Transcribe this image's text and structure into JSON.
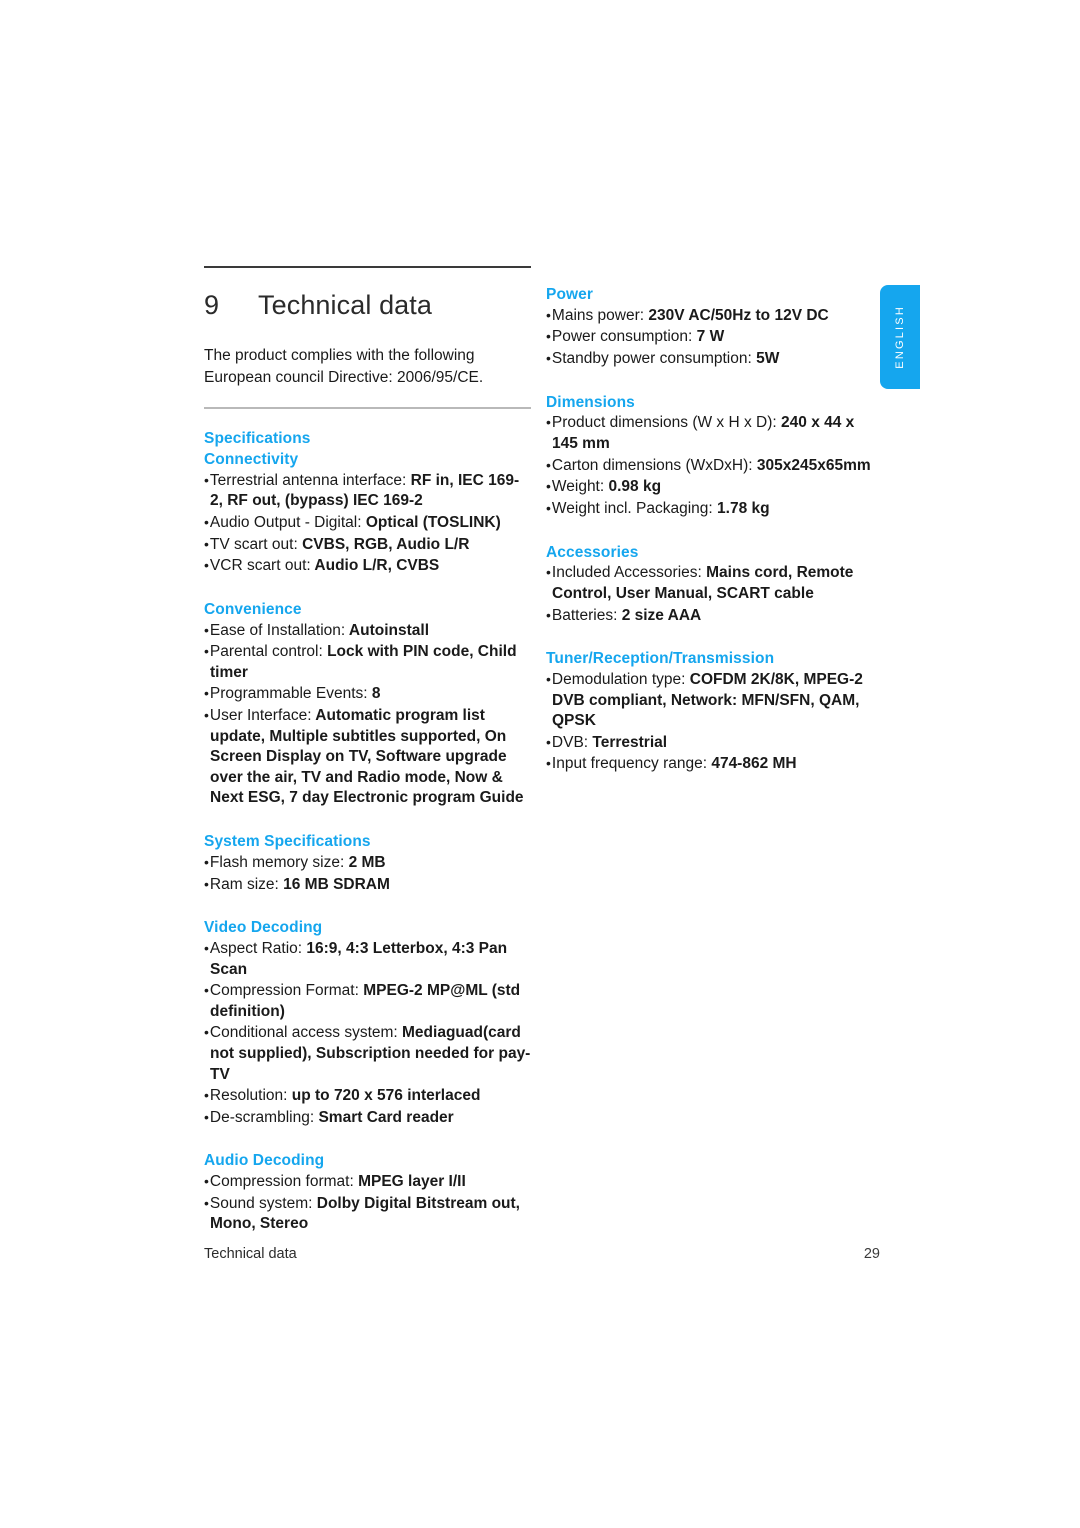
{
  "page": {
    "language_tab": "ENGLISH",
    "accent_color": "#15A6EE",
    "footer_left": "Technical data",
    "footer_page_number": "29"
  },
  "chapter": {
    "number": "9",
    "title": "Technical data",
    "intro": "The product complies with the following European council Directive: 2006/95/CE."
  },
  "left_column": {
    "specifications_heading": "Specifications",
    "sections": [
      {
        "heading": "Connectivity",
        "items": [
          "Terrestrial antenna interface: RF in, IEC 169-2, RF out, (bypass) IEC 169-2",
          "Audio Output - Digital: Optical (TOSLINK)",
          "TV scart out: CVBS, RGB, Audio L/R",
          "VCR scart out: Audio L/R, CVBS"
        ]
      },
      {
        "heading": "Convenience",
        "items": [
          "Ease of Installation: Autoinstall",
          "Parental control: Lock with PIN code, Child timer",
          "Programmable Events: 8",
          "User Interface: Automatic program list update, Multiple subtitles supported, On Screen Display on TV, Software upgrade over the air, TV and Radio mode, Now & Next ESG, 7 day Electronic program Guide"
        ]
      },
      {
        "heading": "System Specifications",
        "items": [
          "Flash memory size: 2 MB",
          "Ram size: 16 MB SDRAM"
        ]
      },
      {
        "heading": "Video Decoding",
        "items": [
          "Aspect Ratio: 16:9, 4:3 Letterbox, 4:3 Pan Scan",
          "Compression Format: MPEG-2 MP@ML (std definition)",
          "Conditional access system: Mediaguad(card not supplied), Subscription needed for pay-TV",
          "Resolution: up to 720 x 576 interlaced",
          "De-scrambling: Smart Card reader"
        ]
      },
      {
        "heading": "Audio Decoding",
        "items": [
          "Compression format: MPEG layer I/II",
          "Sound system: Dolby Digital Bitstream out, Mono, Stereo"
        ]
      }
    ]
  },
  "right_column": {
    "sections": [
      {
        "heading": "Power",
        "items": [
          "Mains power: 230V AC/50Hz to 12V DC",
          "Power consumption: 7 W",
          "Standby power consumption: 5W"
        ]
      },
      {
        "heading": "Dimensions",
        "items": [
          "Product dimensions (W x H x D): 240 x 44 x 145 mm",
          "Carton dimensions (WxDxH): 305x245x65mm",
          "Weight: 0.98 kg",
          "Weight incl. Packaging: 1.78 kg"
        ]
      },
      {
        "heading": "Accessories",
        "items": [
          "Included Accessories: Mains cord, Remote Control, User Manual, SCART cable",
          "Batteries: 2 size AAA"
        ]
      },
      {
        "heading": "Tuner/Reception/Transmission",
        "items": [
          "Demodulation type: COFDM 2K/8K, MPEG-2 DVB compliant, Network: MFN/SFN, QAM, QPSK",
          "DVB: Terrestrial",
          "Input frequency range: 474-862 MH"
        ]
      }
    ]
  }
}
